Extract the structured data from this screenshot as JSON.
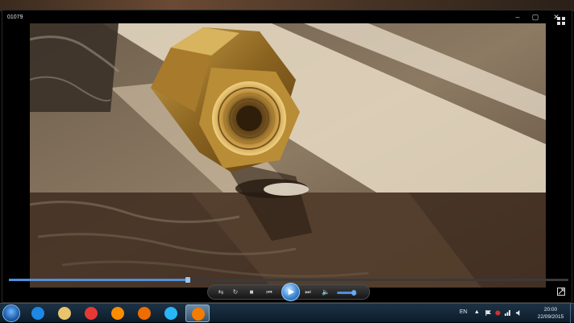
{
  "player": {
    "title": "01079",
    "window_buttons": {
      "minimize": "–",
      "maximize": "▢",
      "close": "✕"
    },
    "seek_progress_percent": 32,
    "volume_percent": 70,
    "controls": {
      "shuffle_icon": "⇆",
      "repeat_icon": "↻",
      "stop_icon": "■",
      "previous_icon": "⏮",
      "play_icon": "▶",
      "next_icon": "⏭",
      "volume_icon": "🔈"
    },
    "accent_color": "#4f8fdc"
  },
  "taskbar": {
    "items": [
      {
        "name": "internet-explorer",
        "color": "#1e88e5",
        "active": false
      },
      {
        "name": "file-explorer",
        "color": "#e9c46a",
        "active": false
      },
      {
        "name": "chrome",
        "color": "#e53935",
        "active": false
      },
      {
        "name": "firefox",
        "color": "#fb8c00",
        "active": false
      },
      {
        "name": "media-app",
        "color": "#ef6c00",
        "active": false
      },
      {
        "name": "skype",
        "color": "#29b6f6",
        "active": false
      },
      {
        "name": "windows-media-player",
        "color": "#f57c00",
        "active": true
      }
    ],
    "language": "EN",
    "time": "20:00",
    "date": "22/09/2015"
  }
}
